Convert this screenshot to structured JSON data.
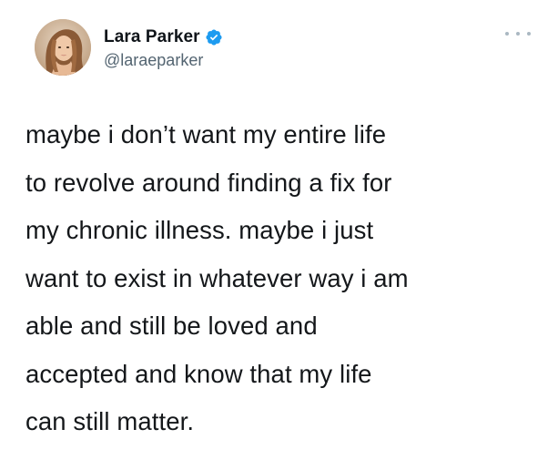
{
  "author": {
    "display_name": "Lara Parker",
    "handle": "@laraeparker",
    "verified": true,
    "avatar_icon": "profile-photo",
    "verified_icon": "verified-badge-icon",
    "verified_color": "#1d9bf0"
  },
  "menu": {
    "icon": "more-options-icon"
  },
  "tweet": {
    "lines": [
      "maybe i don’t want my entire life",
      "to revolve around finding a fix for",
      "my chronic illness. maybe i just",
      "want to exist in whatever way i am",
      "able and still be loved and",
      "accepted and know that my life",
      "can still matter."
    ]
  }
}
